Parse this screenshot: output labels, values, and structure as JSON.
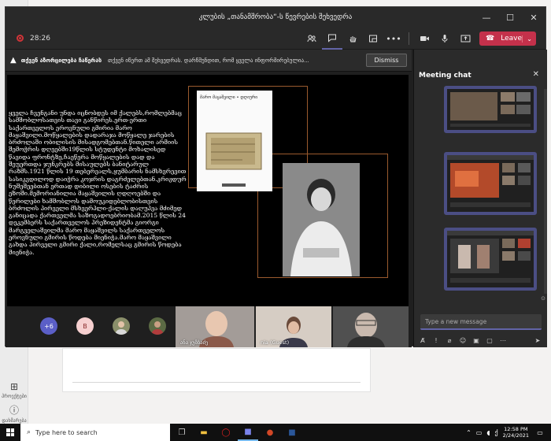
{
  "window": {
    "title": "კლუბის „თანამშრობა“-ს წევრების შეხვედრა",
    "controls": [
      "—",
      "☐",
      "✕"
    ]
  },
  "toolbar": {
    "timer": "28:26",
    "leave_label": "Leave"
  },
  "banner": {
    "title": "თქვენ აზორცილება ჩაწერას",
    "message": "თქვენ იწერთ ამ შეხვედრას. დარწმუნდით, რომ ყველა ინფორმირებულია...",
    "dismiss_label": "Dismiss"
  },
  "slide": {
    "body_text": "ყველა ჩვენგანი უნდა იცნობდეს იმ ქალებს,რომლებმაც სამშობლოსათვის თავი განწირეს.ერთ-ერთი საქართველოს ეროვნული გმირია მარო მაყაშვილი.მოწყალების დადარაჯა მოწყალე ჯარების ბრძოლაში ობილისის მისადგომებთან.წითელი არმიის შემოჭრის დღეებში19წლის სტუდენტი მოხალისედ წავიდა ფრონტზე,ჩაეწერა მოწყალების დად და შეუერთდა ჯუნკრებს მისაულებს ბანიტარულ რაზმს.1921 წლის 19 თებერვალს,ყუმბარის ნამსხვრევით სასიკვდილოდ დაიჭრა კოჯრის დაგრძელებთან.კრიჟდურ ნუშეშეებთან ერთად დიბილი ოსების ტაძრის ეზოში.მემორიანილია მაყაშვილის ღდღოებში და წერილები ხამშობლოს დამოუკიდებლობისთვის ბრძოლის პირველი მსხვერპლი-ქალის დაღუპვა მძიმედ განიცადა ქართველმა საზოგადოებრიობამ.2015 წლის 24 დეკემბერს საქართველოს პრეზიდენტმა გიორგი მარგველაშვილმა მარო მაყაშვილს საქართველოს ეროვნული გმირის წოდება მიენიჭა.მარო მაყაშვილი გახდა პირველი გმირი ქალი,რომელსაც გმირის წოდება მიენიჭა.",
    "book_title": "მარო მაყაშვილი • დღიური"
  },
  "participants": {
    "overflow_count": "+6",
    "initial_avatar": "B",
    "video_tiles": [
      {
        "name": "ანა ჯუმბაძე"
      },
      {
        "name": "nia (Guest)"
      },
      {
        "name": ""
      }
    ]
  },
  "chat": {
    "title": "Meeting chat",
    "input_placeholder": "Type a new message"
  },
  "taskbar": {
    "search_placeholder": "Type here to search",
    "time": "12:58 PM",
    "date": "2/24/2021"
  },
  "sidebar_bg": {
    "items": [
      {
        "label": "პროექტები"
      },
      {
        "label": "დახმარება"
      }
    ]
  },
  "colors": {
    "accent": "#6264a7",
    "leave": "#c4314b",
    "recording": "#d13438",
    "frame": "#9a5a2e"
  }
}
